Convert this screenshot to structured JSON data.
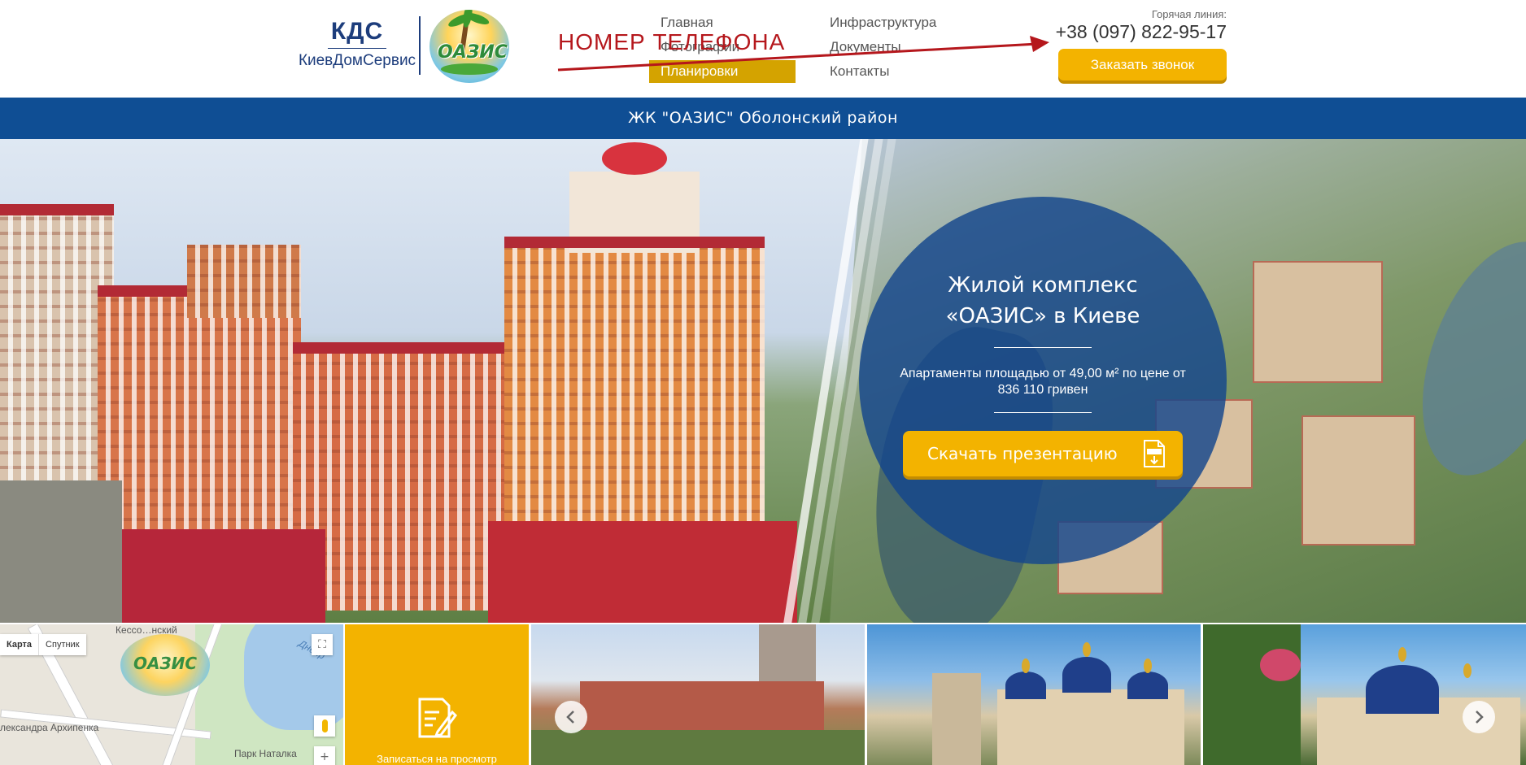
{
  "header": {
    "logo_kds": "КДС",
    "logo_company": "КиевДомСервис",
    "logo_oasis": "ОАЗИС",
    "nav": [
      "Главная",
      "Фотографии",
      "Планировки",
      "Инфраструктура",
      "Документы",
      "Контакты"
    ],
    "nav_active": "Планировки",
    "annotation": "НОМЕР ТЕЛЕФОНА",
    "hotline_label": "Горячая линия:",
    "hotline_phone": "+38 (097) 822-95-17",
    "callback_button": "Заказать звонок"
  },
  "title_bar": "ЖК \"ОАЗИС\" Оболонский район",
  "hero": {
    "title_line1": "Жилой комплекс",
    "title_line2": "«ОАЗИС» в Киеве",
    "subtitle": "Апартаменты площадью от 49,00 м² по цене от 836 110 гривен",
    "download_button": "Скачать презентацию"
  },
  "map": {
    "type_map": "Карта",
    "type_satellite": "Спутник",
    "label_kessel": "Кессо…нский",
    "label_river": "Днепр",
    "label_street": "лександра Архипенка",
    "label_park": "Парк Наталка",
    "zoom_in": "+",
    "fullscreen": "⛶"
  },
  "signup_tile": {
    "label": "Записаться на просмотр"
  },
  "colors": {
    "brand_blue": "#0f4e94",
    "accent_yellow": "#f3b300",
    "annotation_red": "#b5171c"
  }
}
